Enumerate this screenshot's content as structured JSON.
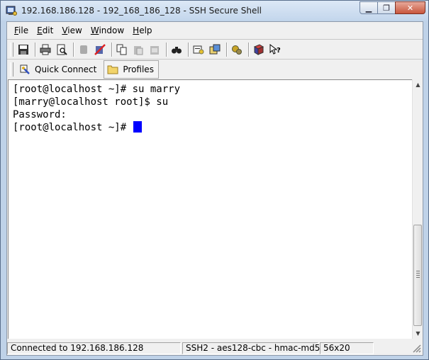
{
  "window": {
    "title": "192.168.186.128 - 192_168_186_128 - SSH Secure Shell"
  },
  "caption": {
    "minimize": "▭",
    "maximize": "❐",
    "close": "✕"
  },
  "menu": [
    {
      "underline": "F",
      "rest": "ile"
    },
    {
      "underline": "E",
      "rest": "dit"
    },
    {
      "underline": "V",
      "rest": "iew"
    },
    {
      "underline": "W",
      "rest": "indow"
    },
    {
      "underline": "H",
      "rest": "elp"
    }
  ],
  "toolbar": {
    "icons": [
      "save-icon",
      "print-icon",
      "print-preview-icon",
      "copy-disabled-icon",
      "disconnect-icon",
      "copy-icon",
      "paste-icon",
      "paste-disabled-icon",
      "find-icon",
      "settings-icon",
      "file-transfer-icon",
      "keygen-icon",
      "help-book-icon",
      "context-help-icon"
    ]
  },
  "quickbar": {
    "quick_connect": "Quick Connect",
    "profiles": "Profiles"
  },
  "terminal": {
    "lines": [
      "[root@localhost ~]# su marry",
      "[marry@localhost root]$ su",
      "Password:",
      "[root@localhost ~]# "
    ]
  },
  "status": {
    "connection": "Connected to 192.168.186.128",
    "cipher": "SSH2 - aes128-cbc - hmac-md5",
    "size": "56x20"
  },
  "colors": {
    "cursor": "#0000ff",
    "titlebar": "#c3d6ec"
  }
}
